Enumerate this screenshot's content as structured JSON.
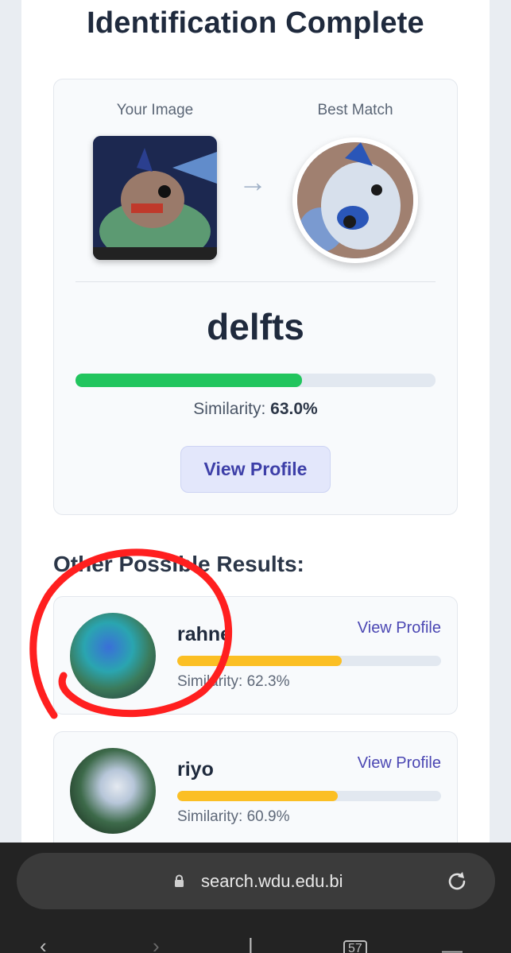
{
  "page": {
    "title": "Identification Complete"
  },
  "best_match_panel": {
    "your_image_label": "Your Image",
    "best_match_label": "Best Match",
    "arrow_icon": "arrow-right-icon",
    "match_name": "delfts",
    "similarity_label": "Similarity:",
    "similarity_value": "63.0%",
    "similarity_fraction": 0.63,
    "bar_color": "#22c55e",
    "view_profile_label": "View Profile"
  },
  "other_results": {
    "heading": "Other Possible Results:",
    "bar_color": "#fbbf24",
    "items": [
      {
        "name": "rahne",
        "view_profile_label": "View Profile",
        "similarity_text": "Similarity: 62.3%",
        "similarity_fraction": 0.623
      },
      {
        "name": "riyo",
        "view_profile_label": "View Profile",
        "similarity_text": "Similarity: 60.9%",
        "similarity_fraction": 0.609
      }
    ]
  },
  "annotation": {
    "color": "#ff1f1f",
    "shape": "hand-drawn circle around first result"
  },
  "browser": {
    "url": "search.wdu.edu.bi",
    "lock_icon": "lock-icon",
    "reload_icon": "reload-icon",
    "tab_count": "57"
  }
}
